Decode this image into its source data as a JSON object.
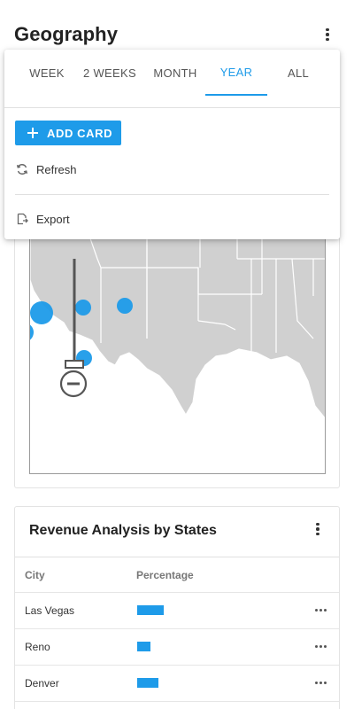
{
  "page": {
    "title": "Geography"
  },
  "colors": {
    "accent": "#1e9be9",
    "map_land": "#d0d0d0",
    "map_border": "#ffffff"
  },
  "dropdown": {
    "tabs": [
      {
        "label": "WEEK",
        "active": false
      },
      {
        "label": "2 WEEKS",
        "active": false
      },
      {
        "label": "MONTH",
        "active": false
      },
      {
        "label": "YEAR",
        "active": true
      },
      {
        "label": "ALL",
        "active": false
      }
    ],
    "add_card_label": "ADD CARD",
    "refresh_label": "Refresh",
    "export_label": "Export"
  },
  "map": {
    "bubble_color": "#1e9be9",
    "zoom_control_icon": "zoom-out-icon"
  },
  "revenue": {
    "title": "Revenue Analysis by States",
    "columns": [
      "City",
      "Percentage"
    ],
    "rows": [
      {
        "city": "Las Vegas",
        "percentage": 0.3
      },
      {
        "city": "Reno",
        "percentage": 0.15
      },
      {
        "city": "Denver",
        "percentage": 0.24
      }
    ]
  }
}
